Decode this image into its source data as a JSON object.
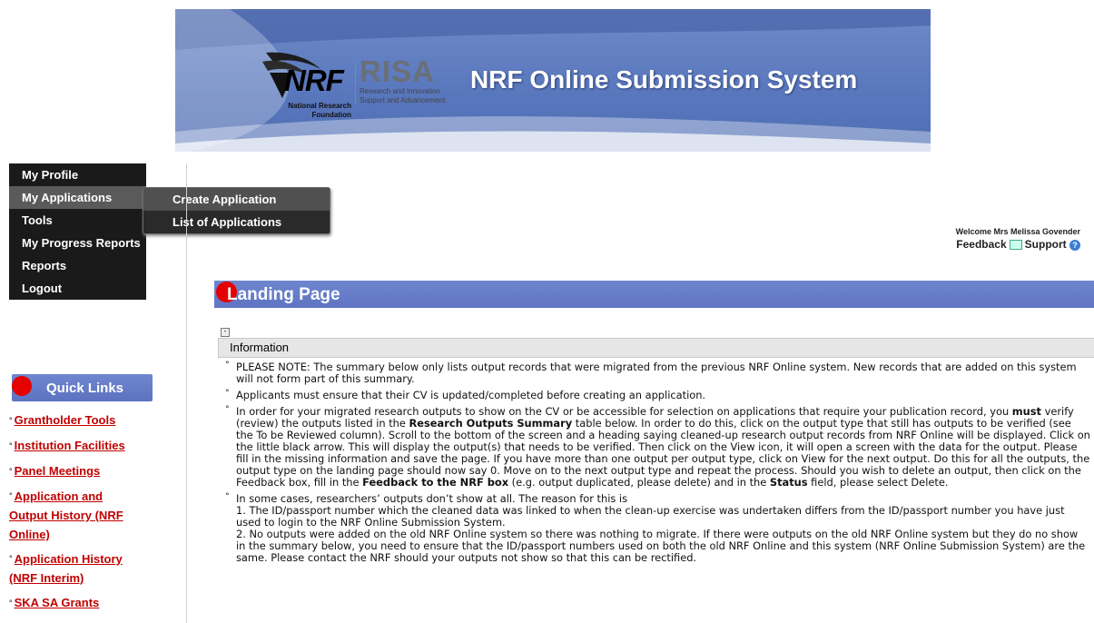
{
  "banner": {
    "nrf_logo": "NRF",
    "nrf_sub_1": "National Research",
    "nrf_sub_2": "Foundation",
    "risa_logo": "RISA",
    "risa_sub_1": "Research and Innovation",
    "risa_sub_2": "Support and Advancement",
    "title": "NRF Online Submission System"
  },
  "nav": {
    "items": [
      {
        "label": "My Profile"
      },
      {
        "label": "My Applications"
      },
      {
        "label": "Tools"
      },
      {
        "label": "My Progress Reports"
      },
      {
        "label": "Reports"
      },
      {
        "label": "Logout"
      }
    ],
    "submenu": [
      {
        "label": "Create Application"
      },
      {
        "label": "List of Applications"
      }
    ]
  },
  "welcome": {
    "text": "Welcome Mrs Melissa Govender",
    "feedback": "Feedback",
    "support": "Support",
    "help_icon": "?"
  },
  "quick_links": {
    "title": "Quick Links",
    "items": [
      {
        "line1": "Grantholder Tools",
        "line2": ""
      },
      {
        "line1": "Institution Facilities",
        "line2": ""
      },
      {
        "line1": "Panel Meetings",
        "line2": ""
      },
      {
        "line1": "Application and",
        "line2": "Output History (NRF",
        "line3": "Online)"
      },
      {
        "line1": "Application History",
        "line2": "(NRF Interim)"
      },
      {
        "line1": "SKA SA Grants",
        "line2": ""
      }
    ]
  },
  "page": {
    "title": "Landing Page",
    "toggle": "-",
    "info_label": "Information",
    "paragraphs": {
      "p1": "PLEASE NOTE: The summary below only lists output records that were migrated from the previous NRF Online system. New records that are added on this system will not form part of this summary.",
      "p2": "Applicants must ensure that their CV is updated/completed before creating an application.",
      "p3a": "In order for your migrated research outputs to show on the CV or be accessible for selection on applications that require your publication record, you ",
      "p3b": "must",
      "p3c": " verify (review) the outputs listed in the ",
      "p3d": "Research Outputs Summary",
      "p3e": " table below. In order to do this, click on the output type that still has outputs to be verified (see the To be Reviewed column). Scroll to the bottom of the screen and a heading saying cleaned-up research output records from NRF Online will be displayed. Click on the little black arrow. This will display the output(s) that needs to be verified. Then click on the View icon, it will open a screen with the data for the output. Please fill in the missing information and save the page. If you have more than one output per output type, click on View for the next output. Do this for all the outputs, the output type on the landing page should now say 0. Move on to the next output type and repeat the process. Should you wish to delete an output, then click on the Feedback box, fill in the ",
      "p3f": "Feedback to the NRF box",
      "p3g": " (e.g. output duplicated, please delete) and in the ",
      "p3h": "Status",
      "p3i": " field, please select Delete.",
      "p4_intro": "In some cases, researchers’ outputs don’t show at all. The reason for this is",
      "p4_1": "1. The ID/passport number which the cleaned data was linked to when the clean-up exercise was undertaken differs from the ID/passport number you have just used to login to the NRF Online Submission System.",
      "p4_2": "2. No outputs were added on the old NRF Online system so there was nothing to migrate. If there were outputs on the old NRF Online system but they do no show in the summary below, you need to ensure that the ID/passport numbers used on both the old NRF Online and this system (NRF Online Submission System) are the same. Please contact the NRF should your outputs not show so that this can be rectified."
    }
  },
  "colors": {
    "banner_blue": "#5a78bd",
    "header_blue": "#6277c4",
    "link_red": "#c00000",
    "dot_red": "#e60000",
    "nav_bg": "#1a1a1a"
  }
}
